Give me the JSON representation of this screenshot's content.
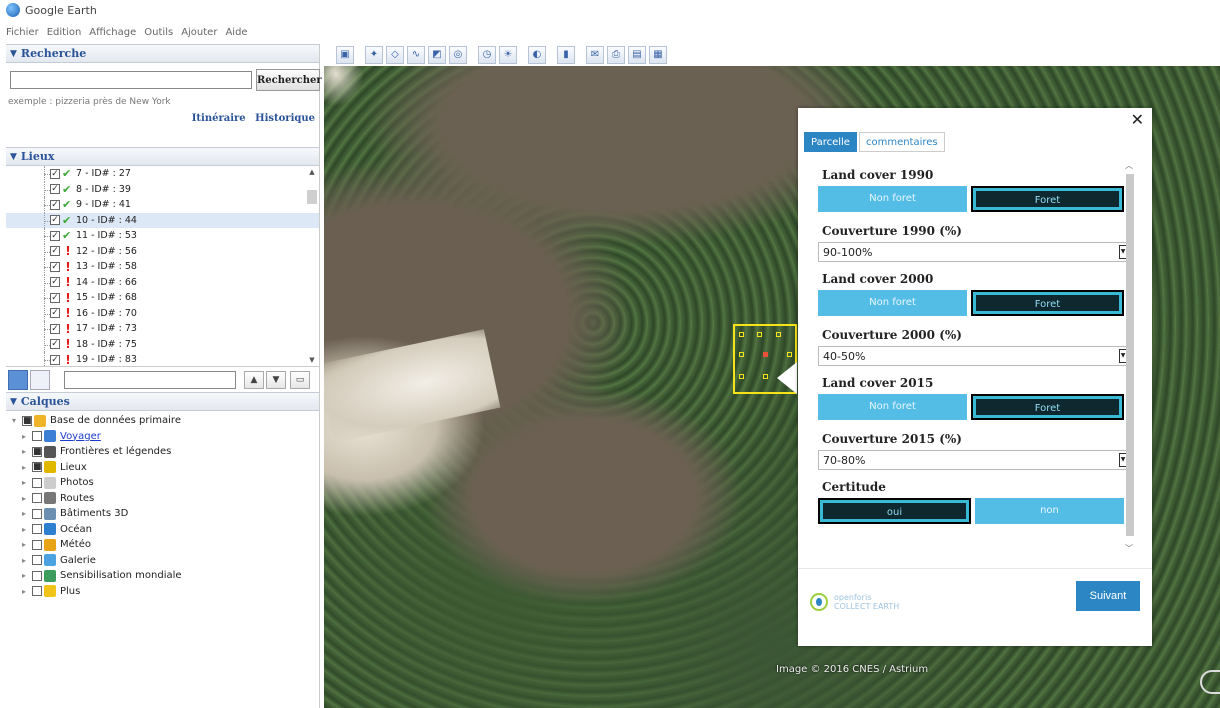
{
  "app": {
    "title": "Google Earth"
  },
  "menu": [
    "Fichier",
    "Edition",
    "Affichage",
    "Outils",
    "Ajouter",
    "Aide"
  ],
  "search": {
    "header": "Recherche",
    "button": "Rechercher",
    "example": "exemple : pizzeria près de New York",
    "links": [
      "Itinéraire",
      "Historique"
    ]
  },
  "places": {
    "header": "Lieux",
    "items": [
      {
        "label": "7 - ID# : 27",
        "status": "ok"
      },
      {
        "label": "8 - ID# : 39",
        "status": "ok"
      },
      {
        "label": "9 - ID# : 41",
        "status": "ok"
      },
      {
        "label": "10 - ID# : 44",
        "status": "ok"
      },
      {
        "label": "11 - ID# : 53",
        "status": "ok"
      },
      {
        "label": "12 - ID# : 56",
        "status": "warn"
      },
      {
        "label": "13 - ID# : 58",
        "status": "warn"
      },
      {
        "label": "14 - ID# : 66",
        "status": "warn"
      },
      {
        "label": "15 - ID# : 68",
        "status": "warn"
      },
      {
        "label": "16 - ID# : 70",
        "status": "warn"
      },
      {
        "label": "17 - ID# : 73",
        "status": "warn"
      },
      {
        "label": "18 - ID# : 75",
        "status": "warn"
      },
      {
        "label": "19 - ID# : 83",
        "status": "warn"
      }
    ],
    "selected": "10 - ID# : 44"
  },
  "layers": {
    "header": "Calques",
    "items": [
      {
        "label": "Base de données primaire",
        "color": "#f0b429"
      },
      {
        "label": "Voyager",
        "color": "#3d7fd6",
        "link": true
      },
      {
        "label": "Frontières et légendes",
        "color": "#555555"
      },
      {
        "label": "Lieux",
        "color": "#e0b800"
      },
      {
        "label": "Photos",
        "color": "#cccccc"
      },
      {
        "label": "Routes",
        "color": "#777777"
      },
      {
        "label": "Bâtiments 3D",
        "color": "#6a8fb0"
      },
      {
        "label": "Océan",
        "color": "#2d7fd0"
      },
      {
        "label": "Météo",
        "color": "#e8a317"
      },
      {
        "label": "Galerie",
        "color": "#4aa3e0"
      },
      {
        "label": "Sensibilisation mondiale",
        "color": "#3c9c5c"
      },
      {
        "label": "Plus",
        "color": "#f0c419"
      }
    ]
  },
  "map": {
    "credit": "Image © 2016 CNES / Astrium"
  },
  "dialog": {
    "tabs": [
      "Parcelle",
      "commentaires"
    ],
    "option_labels": {
      "non_foret": "Non foret",
      "foret": "Foret",
      "oui": "oui",
      "non": "non"
    },
    "questions": {
      "lc1990": "Land cover 1990",
      "cov1990": "Couverture 1990 (%)",
      "cov1990_value": "90-100%",
      "lc2000": "Land cover 2000",
      "cov2000": "Couverture 2000 (%)",
      "cov2000_value": "40-50%",
      "lc2015": "Land cover 2015",
      "cov2015": "Couverture 2015 (%)",
      "cov2015_value": "70-80%",
      "certitude": "Certitude"
    },
    "brand": [
      "openforis",
      "COLLECT EARTH"
    ],
    "next_button": "Suivant"
  }
}
